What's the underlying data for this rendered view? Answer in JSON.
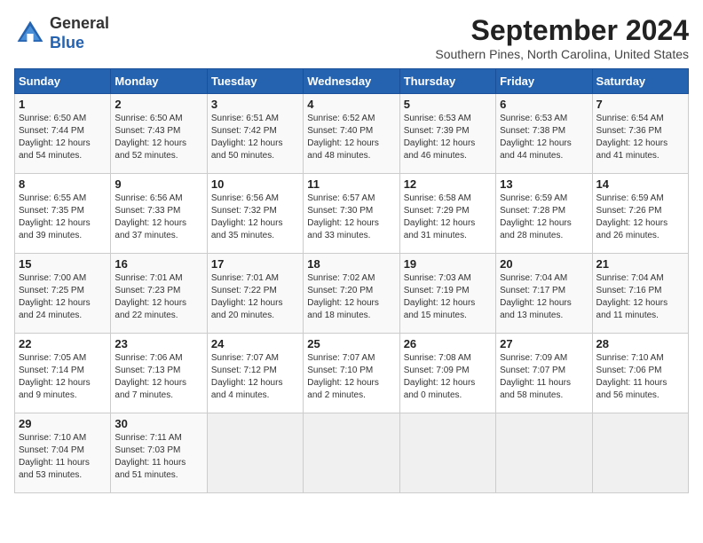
{
  "header": {
    "logo_line1": "General",
    "logo_line2": "Blue",
    "month_title": "September 2024",
    "location": "Southern Pines, North Carolina, United States"
  },
  "days_of_week": [
    "Sunday",
    "Monday",
    "Tuesday",
    "Wednesday",
    "Thursday",
    "Friday",
    "Saturday"
  ],
  "weeks": [
    [
      {
        "day": "1",
        "text": "Sunrise: 6:50 AM\nSunset: 7:44 PM\nDaylight: 12 hours\nand 54 minutes."
      },
      {
        "day": "2",
        "text": "Sunrise: 6:50 AM\nSunset: 7:43 PM\nDaylight: 12 hours\nand 52 minutes."
      },
      {
        "day": "3",
        "text": "Sunrise: 6:51 AM\nSunset: 7:42 PM\nDaylight: 12 hours\nand 50 minutes."
      },
      {
        "day": "4",
        "text": "Sunrise: 6:52 AM\nSunset: 7:40 PM\nDaylight: 12 hours\nand 48 minutes."
      },
      {
        "day": "5",
        "text": "Sunrise: 6:53 AM\nSunset: 7:39 PM\nDaylight: 12 hours\nand 46 minutes."
      },
      {
        "day": "6",
        "text": "Sunrise: 6:53 AM\nSunset: 7:38 PM\nDaylight: 12 hours\nand 44 minutes."
      },
      {
        "day": "7",
        "text": "Sunrise: 6:54 AM\nSunset: 7:36 PM\nDaylight: 12 hours\nand 41 minutes."
      }
    ],
    [
      {
        "day": "8",
        "text": "Sunrise: 6:55 AM\nSunset: 7:35 PM\nDaylight: 12 hours\nand 39 minutes."
      },
      {
        "day": "9",
        "text": "Sunrise: 6:56 AM\nSunset: 7:33 PM\nDaylight: 12 hours\nand 37 minutes."
      },
      {
        "day": "10",
        "text": "Sunrise: 6:56 AM\nSunset: 7:32 PM\nDaylight: 12 hours\nand 35 minutes."
      },
      {
        "day": "11",
        "text": "Sunrise: 6:57 AM\nSunset: 7:30 PM\nDaylight: 12 hours\nand 33 minutes."
      },
      {
        "day": "12",
        "text": "Sunrise: 6:58 AM\nSunset: 7:29 PM\nDaylight: 12 hours\nand 31 minutes."
      },
      {
        "day": "13",
        "text": "Sunrise: 6:59 AM\nSunset: 7:28 PM\nDaylight: 12 hours\nand 28 minutes."
      },
      {
        "day": "14",
        "text": "Sunrise: 6:59 AM\nSunset: 7:26 PM\nDaylight: 12 hours\nand 26 minutes."
      }
    ],
    [
      {
        "day": "15",
        "text": "Sunrise: 7:00 AM\nSunset: 7:25 PM\nDaylight: 12 hours\nand 24 minutes."
      },
      {
        "day": "16",
        "text": "Sunrise: 7:01 AM\nSunset: 7:23 PM\nDaylight: 12 hours\nand 22 minutes."
      },
      {
        "day": "17",
        "text": "Sunrise: 7:01 AM\nSunset: 7:22 PM\nDaylight: 12 hours\nand 20 minutes."
      },
      {
        "day": "18",
        "text": "Sunrise: 7:02 AM\nSunset: 7:20 PM\nDaylight: 12 hours\nand 18 minutes."
      },
      {
        "day": "19",
        "text": "Sunrise: 7:03 AM\nSunset: 7:19 PM\nDaylight: 12 hours\nand 15 minutes."
      },
      {
        "day": "20",
        "text": "Sunrise: 7:04 AM\nSunset: 7:17 PM\nDaylight: 12 hours\nand 13 minutes."
      },
      {
        "day": "21",
        "text": "Sunrise: 7:04 AM\nSunset: 7:16 PM\nDaylight: 12 hours\nand 11 minutes."
      }
    ],
    [
      {
        "day": "22",
        "text": "Sunrise: 7:05 AM\nSunset: 7:14 PM\nDaylight: 12 hours\nand 9 minutes."
      },
      {
        "day": "23",
        "text": "Sunrise: 7:06 AM\nSunset: 7:13 PM\nDaylight: 12 hours\nand 7 minutes."
      },
      {
        "day": "24",
        "text": "Sunrise: 7:07 AM\nSunset: 7:12 PM\nDaylight: 12 hours\nand 4 minutes."
      },
      {
        "day": "25",
        "text": "Sunrise: 7:07 AM\nSunset: 7:10 PM\nDaylight: 12 hours\nand 2 minutes."
      },
      {
        "day": "26",
        "text": "Sunrise: 7:08 AM\nSunset: 7:09 PM\nDaylight: 12 hours\nand 0 minutes."
      },
      {
        "day": "27",
        "text": "Sunrise: 7:09 AM\nSunset: 7:07 PM\nDaylight: 11 hours\nand 58 minutes."
      },
      {
        "day": "28",
        "text": "Sunrise: 7:10 AM\nSunset: 7:06 PM\nDaylight: 11 hours\nand 56 minutes."
      }
    ],
    [
      {
        "day": "29",
        "text": "Sunrise: 7:10 AM\nSunset: 7:04 PM\nDaylight: 11 hours\nand 53 minutes."
      },
      {
        "day": "30",
        "text": "Sunrise: 7:11 AM\nSunset: 7:03 PM\nDaylight: 11 hours\nand 51 minutes."
      },
      {
        "day": "",
        "text": ""
      },
      {
        "day": "",
        "text": ""
      },
      {
        "day": "",
        "text": ""
      },
      {
        "day": "",
        "text": ""
      },
      {
        "day": "",
        "text": ""
      }
    ]
  ]
}
